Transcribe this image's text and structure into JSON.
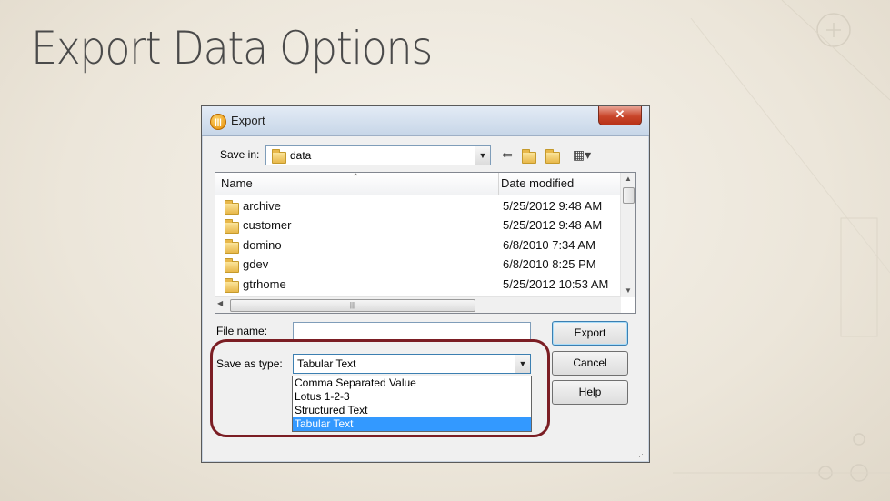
{
  "slide": {
    "title": "Export Data Options"
  },
  "dialog": {
    "title": "Export",
    "close_label": "✕",
    "save_in": {
      "label": "Save in:",
      "value": "data"
    },
    "columns": {
      "name": "Name",
      "date": "Date modified"
    },
    "files": [
      {
        "name": "archive",
        "date": "5/25/2012 9:48 AM"
      },
      {
        "name": "customer",
        "date": "5/25/2012 9:48 AM"
      },
      {
        "name": "domino",
        "date": "6/8/2010 7:34 AM"
      },
      {
        "name": "gdev",
        "date": "6/8/2010 8:25 PM"
      },
      {
        "name": "gtrhome",
        "date": "5/25/2012 10:53 AM"
      }
    ],
    "file_name": {
      "label": "File name:",
      "value": ""
    },
    "save_as_type": {
      "label": "Save as type:",
      "value": "Tabular Text",
      "options": [
        "Comma Separated Value",
        "Lotus 1-2-3",
        "Structured Text",
        "Tabular Text"
      ]
    },
    "buttons": {
      "export": "Export",
      "cancel": "Cancel",
      "help": "Help"
    }
  },
  "colors": {
    "highlight": "#7b1e24",
    "selection": "#3399ff"
  }
}
